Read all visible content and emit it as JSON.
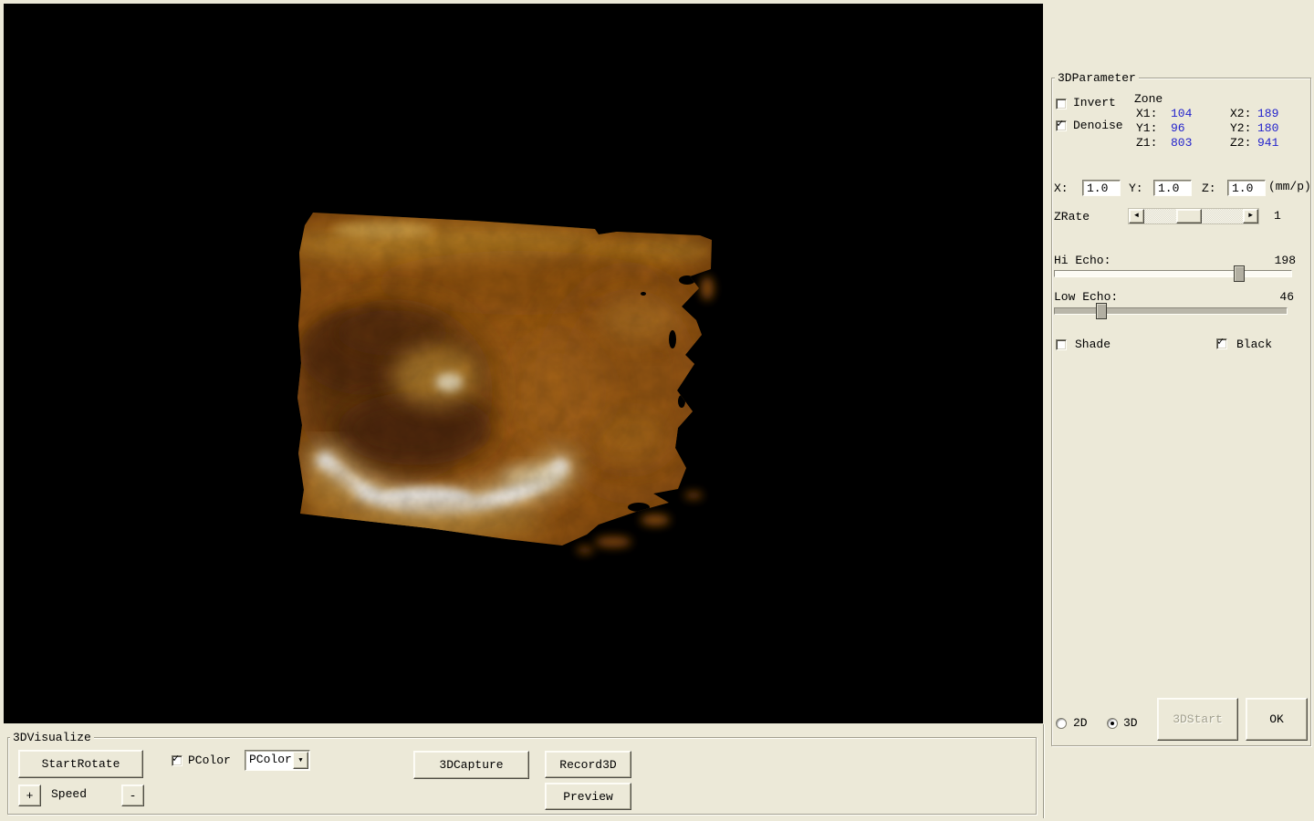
{
  "colors": {
    "background": "#ece9d8",
    "viewport_black": "#000000",
    "zone_value_blue": "#2222cc",
    "render_palette": [
      "#7a430c",
      "#a96317",
      "#6a3a0d",
      "#ffffff"
    ]
  },
  "right_panel": {
    "title": "3DParameter",
    "invert_label": "Invert",
    "invert_checked": false,
    "denoise_label": "Denoise",
    "denoise_checked": true,
    "zone_title": "Zone",
    "zone": {
      "x1_label": "X1:",
      "x1": "104",
      "x2_label": "X2:",
      "x2": "189",
      "y1_label": "Y1:",
      "y1": "96",
      "y2_label": "Y2:",
      "y2": "180",
      "z1_label": "Z1:",
      "z1": "803",
      "z2_label": "Z2:",
      "z2": "941"
    },
    "scale": {
      "x_label": "X:",
      "x": "1.0",
      "y_label": "Y:",
      "y": "1.0",
      "z_label": "Z:",
      "z": "1.0",
      "unit": "(mm/p)"
    },
    "zrate_label": "ZRate",
    "zrate_value": "1",
    "hi_echo_label": "Hi Echo:",
    "hi_echo_value": "198",
    "low_echo_label": "Low Echo:",
    "low_echo_value": "46",
    "shade_label": "Shade",
    "shade_checked": false,
    "black_label": "Black",
    "black_checked": true,
    "mode_2d_label": "2D",
    "mode_2d_selected": false,
    "mode_3d_label": "3D",
    "mode_3d_selected": true,
    "start3d_label": "3DStart",
    "start3d_enabled": false,
    "ok_label": "OK"
  },
  "bottom_panel": {
    "title": "3DVisualize",
    "start_rotate_label": "StartRotate",
    "plus_label": "+",
    "speed_label": "Speed",
    "minus_label": "-",
    "pcolor_label": "PColor",
    "pcolor_checked": true,
    "pcolor_dropdown_value": "PColor",
    "capture_label": "3DCapture",
    "record_label": "Record3D",
    "preview_label": "Preview"
  }
}
